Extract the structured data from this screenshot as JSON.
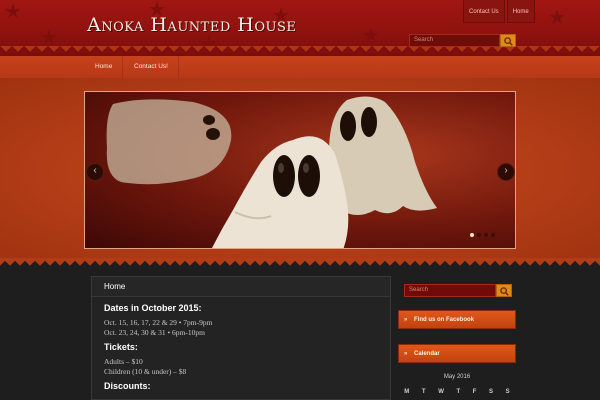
{
  "site": {
    "title": "Anoka Haunted House"
  },
  "top_links": [
    {
      "label": "Contact Us"
    },
    {
      "label": "Home"
    }
  ],
  "header_search": {
    "placeholder": "Search"
  },
  "nav": [
    {
      "label": "Home"
    },
    {
      "label": "Contact Us!"
    }
  ],
  "slider": {
    "slide_count": 4,
    "active_slide": 1
  },
  "content": {
    "title": "Home",
    "dates_heading": "Dates in October 2015:",
    "dates_line1": "Oct. 15, 16, 17, 22 & 29 • 7pm-9pm",
    "dates_line2": "Oct. 23, 24, 30 & 31 • 6pm-10pm",
    "tickets_heading": "Tickets:",
    "tickets_adults": "Adults – $10",
    "tickets_children": "Children (10 & under) – $8",
    "discounts_heading": "Discounts:"
  },
  "sidebar": {
    "search_placeholder": "Search",
    "facebook_label": "Find us on Facebook",
    "calendar_label": "Calendar",
    "calendar_month": "May 2016",
    "calendar_days": [
      "M",
      "T",
      "W",
      "T",
      "F",
      "S",
      "S"
    ]
  },
  "colors": {
    "header": "#9a1510",
    "nav": "#c2401a",
    "accent": "#e0581a",
    "page_bg": "#1e1e1e"
  }
}
